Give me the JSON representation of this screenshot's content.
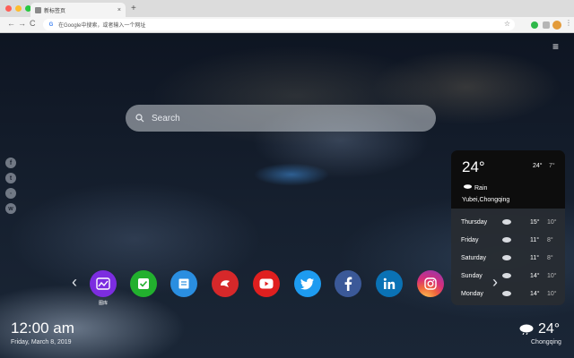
{
  "browser": {
    "tab_title": "新标签页",
    "tab_close": "×",
    "new_tab": "+",
    "back": "←",
    "forward": "→",
    "reload": "C",
    "omnibox_text": "在Google中搜索，或者输入一个网址",
    "omnibox_icon": "G",
    "star": "☆",
    "menu": "⋮"
  },
  "top_menu": "≡",
  "search": {
    "placeholder": "Search"
  },
  "social": [
    {
      "glyph": "f",
      "icon": "facebook-icon"
    },
    {
      "glyph": "t",
      "icon": "twitter-icon"
    },
    {
      "glyph": "◦",
      "icon": "qq-icon"
    },
    {
      "glyph": "w",
      "icon": "wechat-icon"
    }
  ],
  "weather_panel": {
    "temp": "24°",
    "high": "24°",
    "low": "7°",
    "condition": "Rain",
    "location": "Yubei,Chongqing",
    "forecast": [
      {
        "day": "Thursday",
        "high": "15°",
        "low": "10°"
      },
      {
        "day": "Friday",
        "high": "11°",
        "low": "8°"
      },
      {
        "day": "Saturday",
        "high": "11°",
        "low": "8°"
      },
      {
        "day": "Sunday",
        "high": "14°",
        "low": "10°"
      },
      {
        "day": "Monday",
        "high": "14°",
        "low": "10°"
      }
    ]
  },
  "dock": {
    "prev": "‹",
    "next": "›",
    "apps": [
      {
        "name": "gallery",
        "label": "图库",
        "color": "#7c2de0"
      },
      {
        "name": "tasks",
        "label": "",
        "color": "#22b02e"
      },
      {
        "name": "notes",
        "label": "",
        "color": "#2a8ee0"
      },
      {
        "name": "game",
        "label": "",
        "color": "#d6282a"
      },
      {
        "name": "youtube",
        "label": "",
        "color": "#e01f1f"
      },
      {
        "name": "twitter",
        "label": "",
        "color": "#1d9bf0"
      },
      {
        "name": "facebook",
        "label": "",
        "color": "#3b5998"
      },
      {
        "name": "linkedin",
        "label": "",
        "color": "#0a72b5"
      },
      {
        "name": "instagram",
        "label": "",
        "color": "#d62e7a"
      }
    ]
  },
  "clock": {
    "time": "12:00 am",
    "date": "Friday, March 8, 2019"
  },
  "bottom_weather": {
    "temp": "24°",
    "city": "Chongqing"
  }
}
